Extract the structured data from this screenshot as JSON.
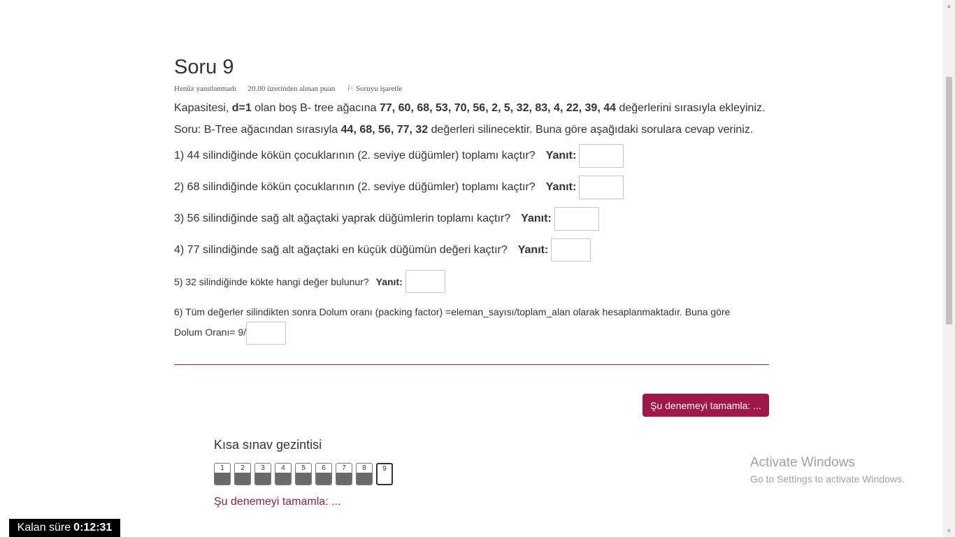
{
  "question": {
    "title": "Soru 9",
    "status": "Henüz yanıtlanmadı",
    "points": "20.00 üzerinden alınan puan",
    "flag_label": "Soruyu işaretle",
    "intro": {
      "p1_a": "Kapasitesi, ",
      "p1_b": "d=1",
      "p1_c": " olan boş B- tree ağacına  ",
      "p1_d": "77, 60, 68, 53,  70, 56, 2, 5, 32, 83, 4, 22, 39, 44",
      "p1_e": " değerlerini sırasıyla ekleyiniz.",
      "p2_a": "Soru: B-Tree ağacından sırasıyla ",
      "p2_b": "44, 68, 56, 77, 32",
      "p2_c": " değerleri silinecektir. Buna göre aşağıdaki sorulara cevap veriniz."
    },
    "answer_label": "Yanıt:",
    "items": [
      {
        "text": "1) 44 silindiğinde kökün çocuklarının (2. seviye düğümler) toplamı kaçtır?",
        "value": ""
      },
      {
        "text": "2) 68 silindiğinde kökün çocuklarının (2. seviye düğümler) toplamı kaçtır?",
        "value": ""
      },
      {
        "text": "3) 56 silindiğinde sağ alt ağaçtaki yaprak düğümlerin toplamı kaçtır?",
        "value": ""
      },
      {
        "text": "4) 77 silindiğinde sağ alt ağaçtaki en küçük düğümün değeri kaçtır?",
        "value": ""
      },
      {
        "text": "5) 32 silindiğinde kökte hangi değer bulunur?",
        "value": ""
      }
    ],
    "q6_line1": "6) Tüm değerler silindikten sonra Dolum oranı (packing factor) =eleman_sayısı/toplam_alan olarak hesaplanmaktadır. Buna göre",
    "q6_line2": "Dolum Oranı= 9/"
  },
  "finish_button": "Şu denemeyi tamamla: ...",
  "navigation": {
    "title": "Kısa sınav gezintisi",
    "buttons": [
      "1",
      "2",
      "3",
      "4",
      "5",
      "6",
      "7",
      "8",
      "9"
    ],
    "current": "9",
    "finish_link": "Şu denemeyi tamamla: ..."
  },
  "watermark": {
    "line1": "Activate Windows",
    "line2": "Go to Settings to activate Windows."
  },
  "timer": {
    "label": "Kalan süre",
    "value": "0:12:31"
  },
  "colors": {
    "accent": "#a0174a",
    "divider": "#8b2046"
  }
}
